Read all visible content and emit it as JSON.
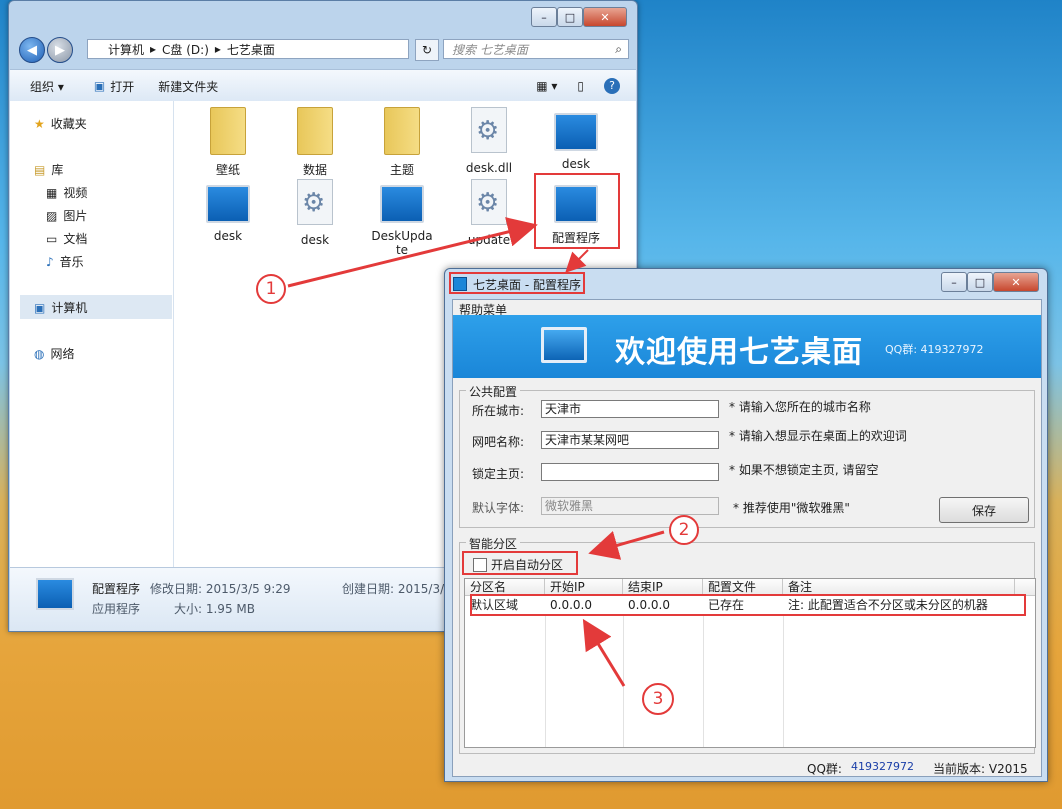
{
  "explorer": {
    "breadcrumb": [
      "计算机",
      "C盘 (D:)",
      "七艺桌面"
    ],
    "search_placeholder": "搜索 七艺桌面",
    "toolbar": {
      "organize": "组织 ▾",
      "open": "打开",
      "new_folder": "新建文件夹"
    },
    "sidebar": {
      "favorites": "收藏夹",
      "library": "库",
      "videos": "视频",
      "pictures": "图片",
      "documents": "文档",
      "music": "音乐",
      "computer": "计算机",
      "network": "网络"
    },
    "files": [
      {
        "name": "壁纸",
        "kind": "folder"
      },
      {
        "name": "数据",
        "kind": "folder"
      },
      {
        "name": "主题",
        "kind": "folder"
      },
      {
        "name": "desk.dll",
        "kind": "gear"
      },
      {
        "name": "desk",
        "kind": "monitor"
      },
      {
        "name": "desk",
        "kind": "monitor"
      },
      {
        "name": "desk",
        "kind": "gear"
      },
      {
        "name": "DeskUpdate",
        "kind": "monitor"
      },
      {
        "name": "update",
        "kind": "gear"
      },
      {
        "name": "配置程序",
        "kind": "monitor"
      }
    ],
    "status": {
      "name": "配置程序",
      "modified_label": "修改日期: 2015/3/5 9:29",
      "created_label": "创建日期: 2015/3/",
      "type": "应用程序",
      "size_label": "大小: 1.95 MB"
    }
  },
  "dialog": {
    "title": "七艺桌面 - 配置程序",
    "menu": "帮助菜单",
    "banner_title": "欢迎使用七艺桌面",
    "banner_qq": "QQ群: 419327972",
    "public_group": "公共配置",
    "city_label": "所在城市:",
    "city_value": "天津市",
    "city_hint": "* 请输入您所在的城市名称",
    "netbar_label": "网吧名称:",
    "netbar_value": "天津市某某网吧",
    "netbar_hint": "* 请输入想显示在桌面上的欢迎词",
    "homepage_label": "锁定主页:",
    "homepage_value": "",
    "homepage_hint": "* 如果不想锁定主页, 请留空",
    "font_label": "默认字体:",
    "font_value": "微软雅黑",
    "font_hint": "* 推荐使用\"微软雅黑\"",
    "save_button": "保存",
    "smart_group": "智能分区",
    "auto_partition": "开启自动分区",
    "auto_partition_checked": false,
    "columns": [
      "分区名",
      "开始IP",
      "结束IP",
      "配置文件",
      "备注"
    ],
    "rows": [
      [
        "默认区域",
        "0.0.0.0",
        "0.0.0.0",
        "已存在",
        "注: 此配置适合不分区或未分区的机器"
      ]
    ],
    "footer_qq_label": "QQ群:",
    "footer_qq_value": "419327972",
    "version": "当前版本: V2015"
  },
  "annotations": {
    "c1": "1",
    "c2": "2",
    "c3": "3"
  },
  "colors": {
    "annotation_red": "#e33a3a",
    "banner_blue": "#1a86d8"
  }
}
